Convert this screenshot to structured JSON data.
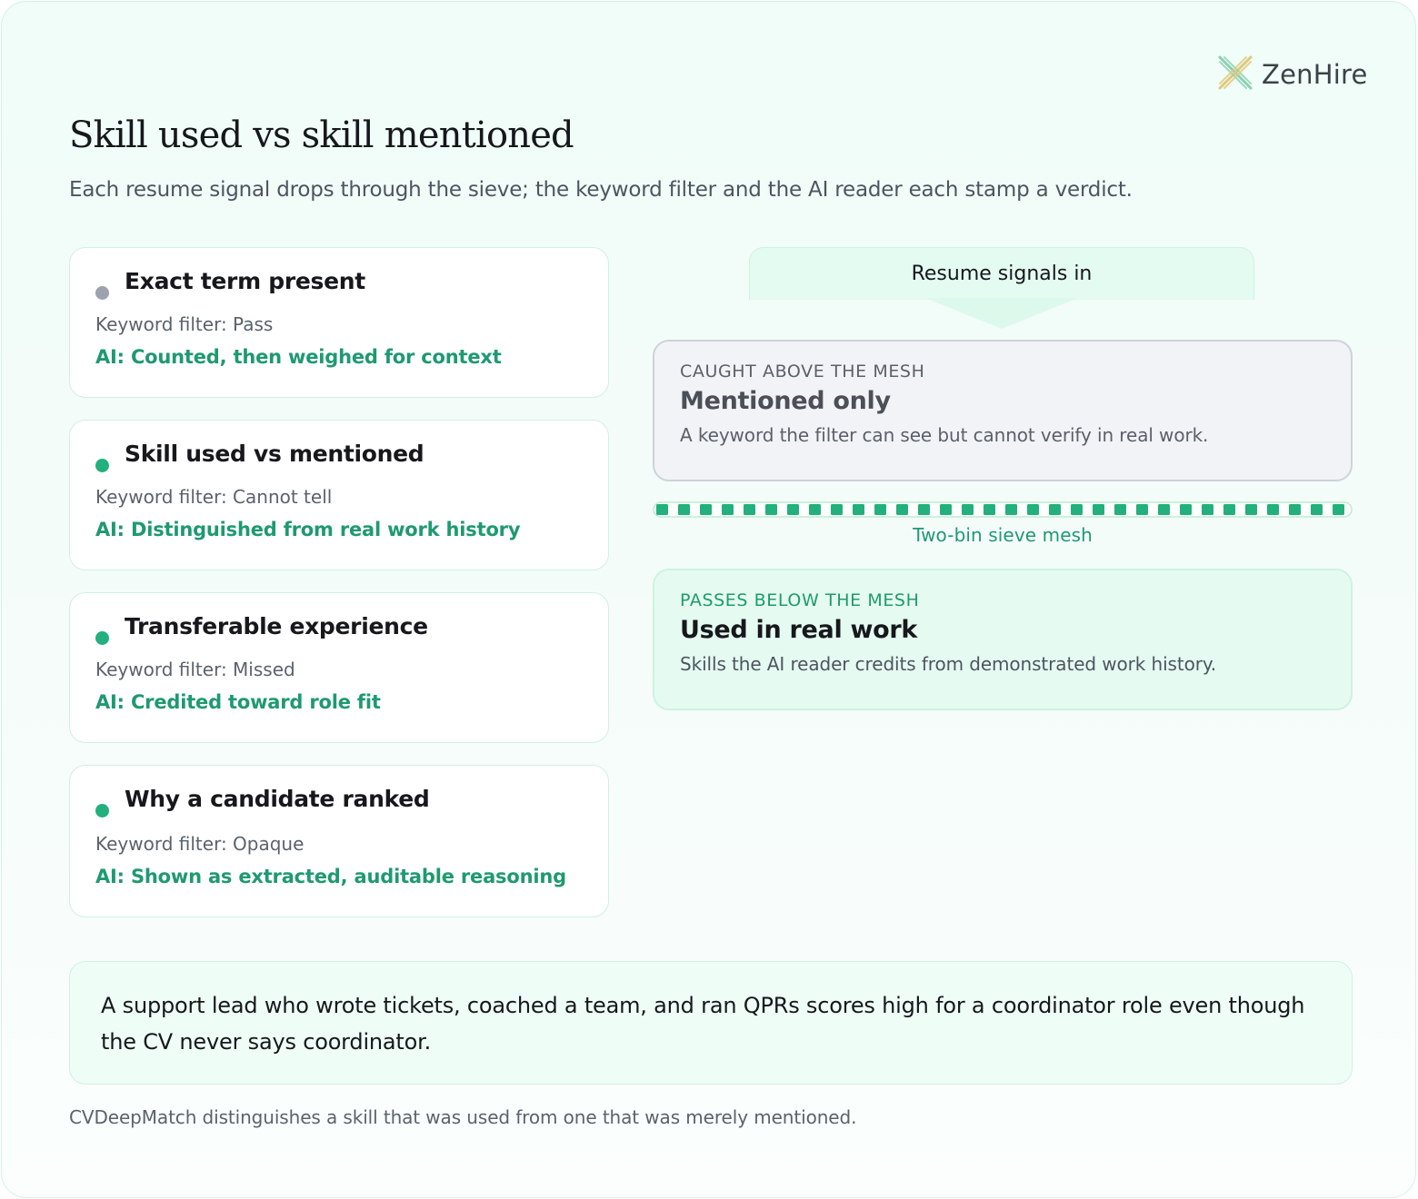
{
  "brand": {
    "name": "ZenHire",
    "logo_icon": "zenhire-logo-icon"
  },
  "header": {
    "title": "Skill used vs skill mentioned",
    "subtitle": "Each resume signal drops through the sieve; the keyword filter and the AI reader each stamp a verdict."
  },
  "signals": [
    {
      "title": "Exact term present",
      "keyword": "Keyword filter: Pass",
      "ai": "AI: Counted, then weighed for context",
      "dot_color": "#9ca3af"
    },
    {
      "title": "Skill used vs mentioned",
      "keyword": "Keyword filter: Cannot tell",
      "ai": "AI: Distinguished from real work history",
      "dot_color": "#22b07d"
    },
    {
      "title": "Transferable experience",
      "keyword": "Keyword filter: Missed",
      "ai": "AI: Credited toward role fit",
      "dot_color": "#22b07d"
    },
    {
      "title": "Why a candidate ranked",
      "keyword": "Keyword filter: Opaque",
      "ai": "AI: Shown as extracted, auditable reasoning",
      "dot_color": "#22b07d"
    }
  ],
  "sieve": {
    "input_label": "Resume signals in",
    "upper_bin": {
      "kicker": "CAUGHT ABOVE THE MESH",
      "title": "Mentioned only",
      "description": "A keyword the filter can see but cannot verify in real work."
    },
    "mesh_label": "Two-bin sieve mesh",
    "lower_bin": {
      "kicker": "PASSES BELOW THE MESH",
      "title": "Used in real work",
      "description": "Skills the AI reader credits from demonstrated work history."
    }
  },
  "example": "A support lead who wrote tickets, coached a team, and ran QPRs scores high for a coordinator role even though the CV never says coordinator.",
  "footer": "CVDeepMatch distinguishes a skill that was used from one that was merely mentioned.",
  "colors": {
    "accent": "#1f9a6e",
    "accent_bright": "#22b07d",
    "neutral_dot": "#9ca3af"
  }
}
